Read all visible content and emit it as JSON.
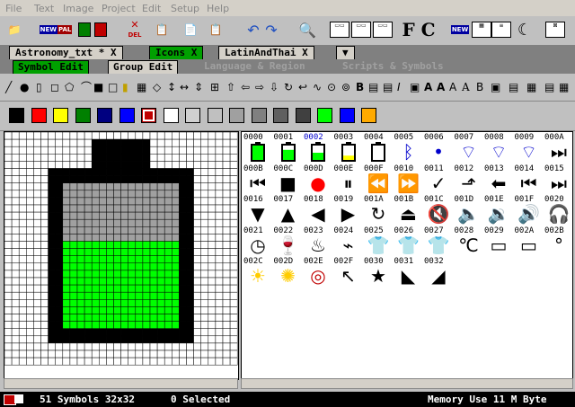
{
  "menu": [
    "File",
    "Text",
    "Image",
    "Project",
    "Edit",
    "Setup",
    "Help"
  ],
  "toolbar": {
    "new_label": "NEW",
    "pal_label": "PAL",
    "del_label": "DEL",
    "fc_label": "F C",
    "new2_label": "NEW"
  },
  "tabs1": [
    {
      "label": "Astronomy_txt * X",
      "active": false
    },
    {
      "label": "Icons X",
      "active": true
    },
    {
      "label": "LatinAndThai X",
      "active": false
    },
    {
      "label": "▼",
      "active": false
    }
  ],
  "tabs2": [
    {
      "label": "Symbol Edit",
      "active": true
    },
    {
      "label": "Group Edit",
      "active": false
    },
    {
      "label": "Language & Region",
      "active": false
    },
    {
      "label": "Scripts & Symbols",
      "active": false
    }
  ],
  "colors": {
    "green": "#00ff00",
    "black": "#000000",
    "gray": "#a0a0a0",
    "accent": "#00a000",
    "blue": "#0000cc",
    "red": "#ff0000"
  },
  "palette": [
    "#000000",
    "#ff0000",
    "#ffff00",
    "#008000",
    "#000080",
    "#0000ff",
    "#c00000",
    "#ffffff",
    "#d0d0d0",
    "#c0c0c0",
    "#a0a0a0",
    "#808080",
    "#606060",
    "#404040",
    "#00ff00",
    "#0000ff",
    "#ffaa00"
  ],
  "symbols": [
    {
      "code": "0000",
      "icon": "battery-full"
    },
    {
      "code": "0001",
      "icon": "battery-high"
    },
    {
      "code": "0002",
      "icon": "battery-medium"
    },
    {
      "code": "0003",
      "icon": "battery-low"
    },
    {
      "code": "0004",
      "icon": "battery-empty"
    },
    {
      "code": "0005",
      "icon": "bluetooth"
    },
    {
      "code": "0006",
      "icon": "wifi-0"
    },
    {
      "code": "0007",
      "icon": "wifi-1"
    },
    {
      "code": "0008",
      "icon": "wifi-2"
    },
    {
      "code": "0009",
      "icon": "wifi-3"
    },
    {
      "code": "000A",
      "icon": "skip-next"
    },
    {
      "code": "000B",
      "icon": "skip-previous"
    },
    {
      "code": "000C",
      "icon": "stop"
    },
    {
      "code": "000D",
      "icon": "record"
    },
    {
      "code": "000E",
      "icon": "pause"
    },
    {
      "code": "000F",
      "icon": "rewind"
    },
    {
      "code": "0010",
      "icon": "fast-forward"
    },
    {
      "code": "0011",
      "icon": "check"
    },
    {
      "code": "0012",
      "icon": "arrow-up-right"
    },
    {
      "code": "0013",
      "icon": "arrow-left"
    },
    {
      "code": "0014",
      "icon": "first"
    },
    {
      "code": "0015",
      "icon": "last"
    },
    {
      "code": "0016",
      "icon": "triangle-down"
    },
    {
      "code": "0017",
      "icon": "triangle-up"
    },
    {
      "code": "0018",
      "icon": "triangle-left"
    },
    {
      "code": "0019",
      "icon": "triangle-right"
    },
    {
      "code": "001A",
      "icon": "refresh"
    },
    {
      "code": "001B",
      "icon": "eject"
    },
    {
      "code": "001C",
      "icon": "mute"
    },
    {
      "code": "001D",
      "icon": "volume-1"
    },
    {
      "code": "001E",
      "icon": "volume-2"
    },
    {
      "code": "001F",
      "icon": "volume-3"
    },
    {
      "code": "0020",
      "icon": "headphones"
    },
    {
      "code": "0021",
      "icon": "clock"
    },
    {
      "code": "0022",
      "icon": "wine-glass"
    },
    {
      "code": "0023",
      "icon": "dish"
    },
    {
      "code": "0024",
      "icon": "iron"
    },
    {
      "code": "0025",
      "icon": "shirt-pattern"
    },
    {
      "code": "0026",
      "icon": "shirt-red"
    },
    {
      "code": "0027",
      "icon": "shirt-outline"
    },
    {
      "code": "0028",
      "icon": "thermometer"
    },
    {
      "code": "0029",
      "icon": "microwave"
    },
    {
      "code": "002A",
      "icon": "oven"
    },
    {
      "code": "002B",
      "icon": "dot"
    },
    {
      "code": "002C",
      "icon": "sun"
    },
    {
      "code": "002D",
      "icon": "fan"
    },
    {
      "code": "002E",
      "icon": "spiral"
    },
    {
      "code": "002F",
      "icon": "cursor"
    },
    {
      "code": "0030",
      "icon": "star"
    },
    {
      "code": "0031",
      "icon": "arrow-shape-1"
    },
    {
      "code": "0032",
      "icon": "arrow-shape-2"
    }
  ],
  "status": {
    "count": "51 Symbols 32x32",
    "selected": "0 Selected",
    "memory": "Memory Use 11 M Byte"
  }
}
